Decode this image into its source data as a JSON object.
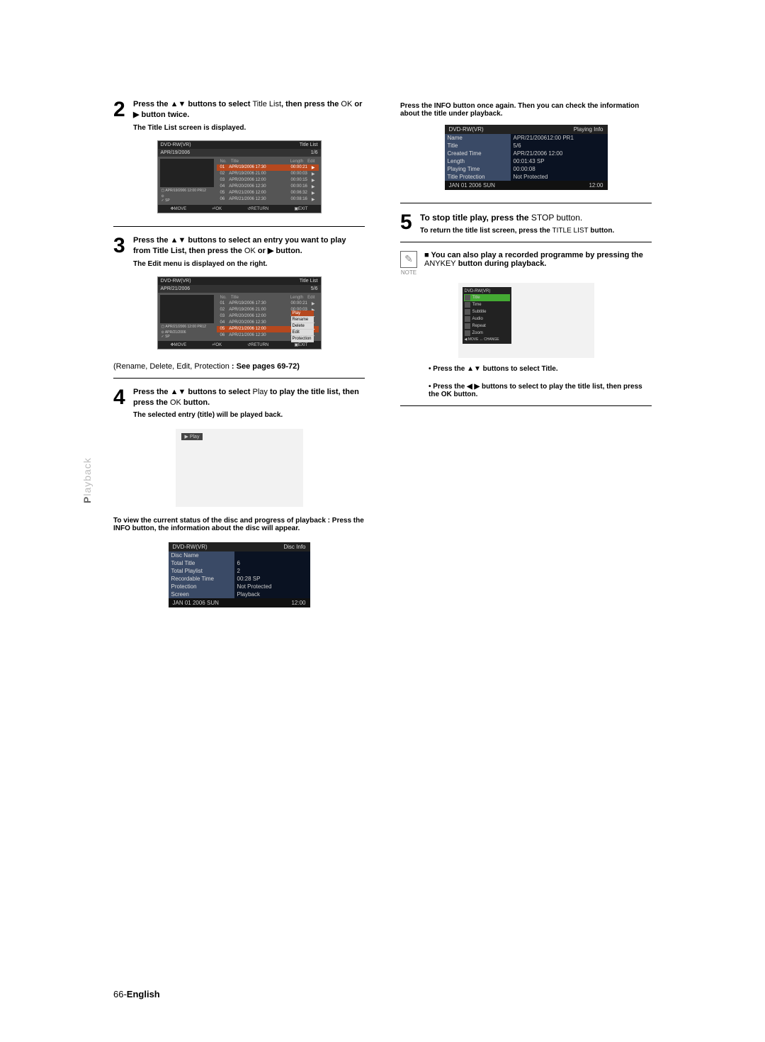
{
  "sideTab": {
    "prefix": "P",
    "text": "layback"
  },
  "step2": {
    "num": "2",
    "main": "Press the ▲▼ buttons to select ",
    "titleList": "Title List",
    "then": ", then press the ",
    "ok": "OK",
    "or": " or ▶ button twice.",
    "sub": "The Title List screen is displayed."
  },
  "tv1": {
    "topLeft": "DVD-RW(VR)",
    "topRight": "Title List",
    "date": "APR/19/2006",
    "counter": "1/6",
    "stamp": "APR/19/2006 12:00 PR12",
    "mode": "SP",
    "cols": {
      "no": "No.",
      "title": "Title",
      "length": "Length",
      "edit": "Edit"
    },
    "rows": [
      {
        "no": "01",
        "title": "APR/19/2006 17:30",
        "length": "00:00:21",
        "hl": true
      },
      {
        "no": "02",
        "title": "APR/19/2006 21:00",
        "length": "00:00:03"
      },
      {
        "no": "03",
        "title": "APR/20/2006 12:00",
        "length": "00:00:15"
      },
      {
        "no": "04",
        "title": "APR/20/2006 12:30",
        "length": "00:00:16"
      },
      {
        "no": "05",
        "title": "APR/21/2006 12:00",
        "length": "00:06:32"
      },
      {
        "no": "06",
        "title": "APR/21/2006 12:30",
        "length": "00:08:16"
      }
    ],
    "footer": {
      "move": "MOVE",
      "ok": "OK",
      "ret": "RETURN",
      "exit": "EXIT"
    }
  },
  "step3": {
    "num": "3",
    "main": "Press the ▲▼ buttons to select an entry you want to play from Title List, then press the ",
    "ok": "OK",
    "or": " or ▶ button.",
    "sub": "The Edit menu is displayed on the right."
  },
  "tv2": {
    "topLeft": "DVD-RW(VR)",
    "topRight": "Title List",
    "date": "APR/21/2006",
    "counter": "5/6",
    "stamp": "APR/21/2006 12:00 PR12",
    "name": "APR/21/2006",
    "mode": "SP",
    "popup": [
      "Play",
      "Rename",
      "Delete",
      "Edit",
      "Protection"
    ]
  },
  "editNote": {
    "pre": "(",
    "items": "Rename, Delete, Edit, Protection",
    "post": " : See pages 69-72)"
  },
  "step4": {
    "num": "4",
    "main": "Press the ▲▼ buttons to select ",
    "play": "Play",
    "then": " to play the title list, then press the ",
    "ok": "OK",
    "end": " button.",
    "sub": "The selected entry (title) will be played back."
  },
  "playBtn": "▶ Play",
  "viewStatus": "To view the current status of the disc and progress of playback : Press the INFO button, the information about the disc will appear.",
  "discInfo": {
    "header": {
      "left": "DVD-RW(VR)",
      "right": "Disc Info"
    },
    "rows": [
      {
        "label": "Disc Name",
        "value": ""
      },
      {
        "label": "Total Title",
        "value": "6"
      },
      {
        "label": "Total Playlist",
        "value": "2"
      },
      {
        "label": "Recordable Time",
        "value": "00:28  SP"
      },
      {
        "label": "Protection",
        "value": "Not Protected"
      },
      {
        "label": "Screen",
        "value": "Playback"
      }
    ],
    "footer": {
      "left": "JAN 01 2006 SUN",
      "right": "12:00"
    }
  },
  "infoAgain": "Press the INFO button once again. Then you can check the information about the title under playback.",
  "playingInfo": {
    "header": {
      "left": "DVD-RW(VR)",
      "right": "Playing Info"
    },
    "rows": [
      {
        "label": "Name",
        "value": "APR/21/200612:00 PR1"
      },
      {
        "label": "Title",
        "value": "5/6"
      },
      {
        "label": "Created Time",
        "value": "APR/21/2006 12:00"
      },
      {
        "label": "Length",
        "value": "00:01:43 SP"
      },
      {
        "label": "Playing Time",
        "value": "00:00:08"
      },
      {
        "label": "Title Protection",
        "value": "Not Protected"
      }
    ],
    "footer": {
      "left": "JAN 01 2006 SUN",
      "right": "12:00"
    }
  },
  "step5": {
    "num": "5",
    "main": "To stop title play, press the ",
    "stop": "STOP",
    "end": " button.",
    "sub1": "To return the title list screen, press the ",
    "sub2": "TITLE LIST",
    "sub3": " button."
  },
  "note": {
    "label": "NOTE",
    "text1": "You can also play a recorded programme by pressing the ",
    "anykey": "ANYKEY",
    "text2": " button during playback."
  },
  "anykeyScreen": {
    "title": "DVD-RW(VR)",
    "items": [
      "Title",
      "Time",
      "Subtitle",
      "Audio",
      "Repeat",
      "Zoom"
    ],
    "footer": "◀ MOVE    ↔ CHANGE"
  },
  "noteSub1": "Press the ▲▼ buttons to select Title.",
  "noteSub2": "Press the ◀ ▶ buttons to select to play the title list, then press the OK button.",
  "pageFooter": {
    "num": "66-",
    "lang": "English"
  }
}
